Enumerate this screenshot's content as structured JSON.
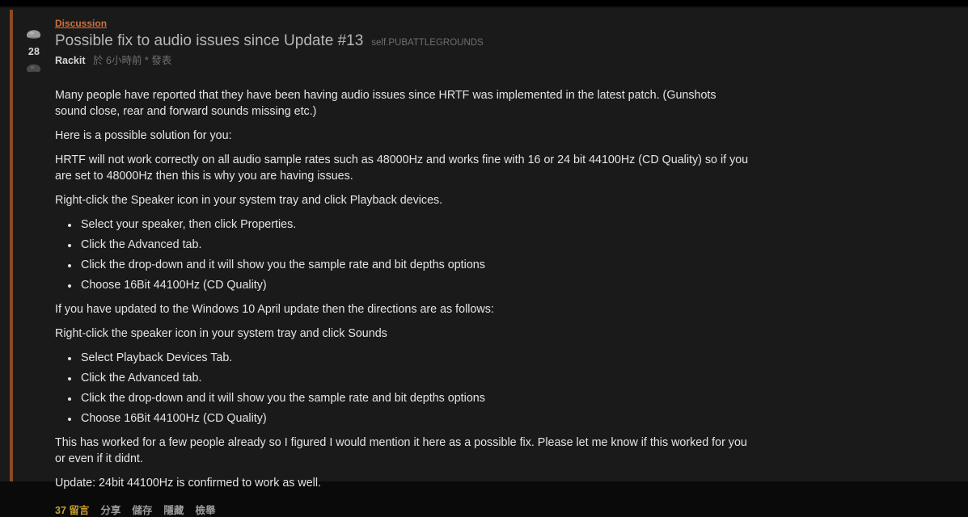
{
  "post": {
    "flair": "Discussion",
    "title": "Possible fix to audio issues since Update #13",
    "domain": "self.PUBATTLEGROUNDS",
    "score": "28",
    "author": "Rackit",
    "meta": "於 6小時前 * 發表",
    "upvote_icon": "helmet-upvote-icon",
    "downvote_icon": "helmet-downvote-icon",
    "flair_color": "#d2713a",
    "stripe_color": "#8a4a22",
    "comments_color": "#c8a02c"
  },
  "body": {
    "para1": "Many people have reported that they have been having audio issues since HRTF was implemented in the latest patch. (Gunshots sound close, rear and forward sounds missing etc.)",
    "para2": "Here is a possible solution for you:",
    "para3": "HRTF will not work correctly on all audio sample rates such as 48000Hz and works fine with 16 or 24 bit 44100Hz (CD Quality) so if you are set to 48000Hz then this is why you are having issues.",
    "para4": "Right-click the Speaker icon in your system tray and click Playback devices.",
    "list1": [
      "Select your speaker, then click Properties.",
      "Click the Advanced tab.",
      "Click the drop-down and it will show you the sample rate and bit depths options",
      "Choose 16Bit 44100Hz (CD Quality)"
    ],
    "para5": "If you have updated to the Windows 10 April update then the directions are as follows:",
    "para6": "Right-click the speaker icon in your system tray and click Sounds",
    "list2": [
      "Select Playback Devices Tab.",
      "Click the Advanced tab.",
      "Click the drop-down and it will show you the sample rate and bit depths options",
      "Choose 16Bit 44100Hz (CD Quality)"
    ],
    "para7": "This has worked for a few people already so I figured I would mention it here as a possible fix. Please let me know if this worked for you or even if it didnt.",
    "para8": "Update: 24bit 44100Hz is confirmed to work as well."
  },
  "actions": {
    "comments": "37 留言",
    "share": "分享",
    "save": "儲存",
    "hide": "隱藏",
    "report": "檢舉"
  }
}
